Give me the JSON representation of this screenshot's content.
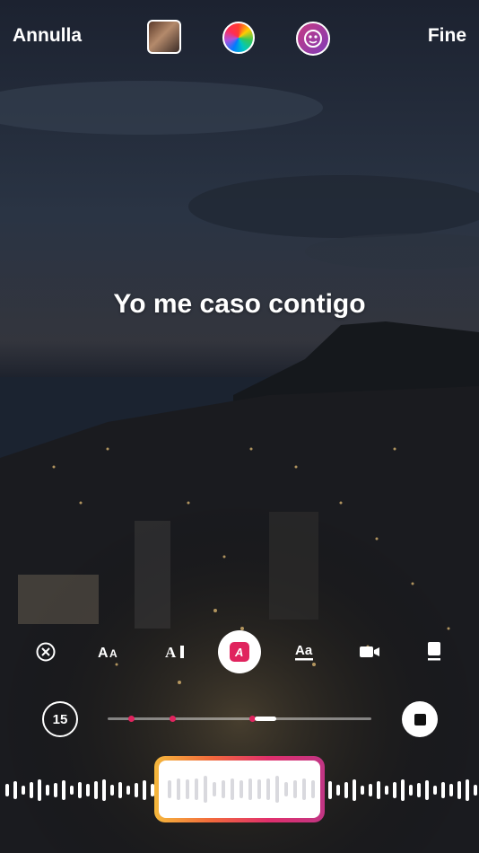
{
  "header": {
    "cancel_label": "Annulla",
    "done_label": "Fine"
  },
  "lyric": {
    "text": "Yo me caso contigo"
  },
  "playback": {
    "duration": "15",
    "progress": 0.6
  },
  "colors": {
    "accent": "#e0245e",
    "gradient": [
      "#f5b83c",
      "#f26a3c",
      "#e1306c",
      "#c13584"
    ]
  },
  "tools": [
    {
      "icon": "close-circle-icon"
    },
    {
      "icon": "text-size-icon"
    },
    {
      "icon": "text-cursor-icon"
    },
    {
      "icon": "font-style-icon"
    },
    {
      "icon": "text-underline-icon"
    },
    {
      "icon": "video-camera-icon"
    },
    {
      "icon": "card-style-icon"
    }
  ]
}
